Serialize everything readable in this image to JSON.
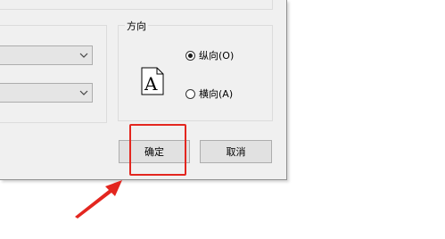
{
  "orientation": {
    "title": "方向",
    "page_icon_letter": "A",
    "options": [
      {
        "label": "纵向(O)",
        "checked": true
      },
      {
        "label": "横向(A)",
        "checked": false
      }
    ]
  },
  "buttons": {
    "ok_label": "确定",
    "cancel_label": "取消"
  },
  "annotation": {
    "highlight_color": "#e3261f"
  },
  "icons": {
    "combo_chevron": "chevron-down-icon",
    "page": "portrait-page-icon",
    "arrow": "red-arrow-icon"
  }
}
